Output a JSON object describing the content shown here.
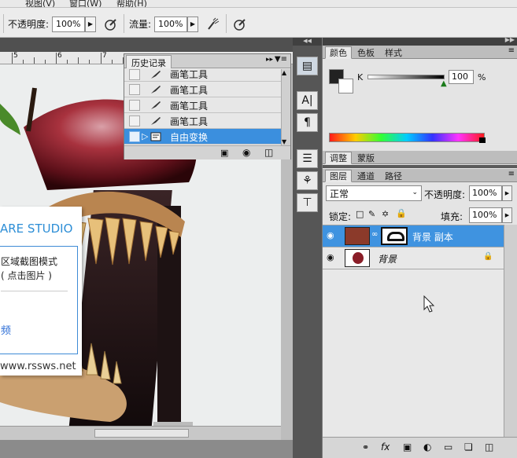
{
  "menubar": {
    "items": [
      "视图(V)",
      "窗口(W)",
      "帮助(H)"
    ]
  },
  "options": {
    "opacity_label": "不透明度:",
    "opacity_value": "100%",
    "flow_label": "流量:",
    "flow_value": "100%"
  },
  "ruler": {
    "labels": [
      "5",
      "6",
      "7"
    ]
  },
  "dialog": {
    "title": "ARE STUDIO",
    "line1": "区域截图模式",
    "line2": "( 点击图片 )",
    "link": "频",
    "url": "www.rssws.net"
  },
  "history": {
    "tab": "历史记录",
    "rows": [
      {
        "label": "画笔工具",
        "selected": false
      },
      {
        "label": "画笔工具",
        "selected": false
      },
      {
        "label": "画笔工具",
        "selected": false
      },
      {
        "label": "画笔工具",
        "selected": false
      },
      {
        "label": "自由变换",
        "selected": true
      }
    ]
  },
  "color_panel": {
    "tabs": [
      "颜色",
      "色板",
      "样式"
    ],
    "channel_label": "K",
    "value": "100",
    "unit": "%",
    "slider_level": 1.0
  },
  "adjust_panel": {
    "tabs": [
      "调整",
      "蒙版"
    ]
  },
  "layers_panel": {
    "tabs": [
      "图层",
      "通道",
      "路径"
    ],
    "blend_mode": "正常",
    "opacity_label": "不透明度:",
    "opacity_value": "100%",
    "lock_label": "锁定:",
    "fill_label": "填充:",
    "fill_value": "100%",
    "layers": [
      {
        "name": "背景 副本",
        "selected": true
      },
      {
        "name": "背景",
        "selected": false
      }
    ]
  },
  "colors": {
    "accent": "#3b8fde",
    "dialog_title": "#2d8ed6"
  }
}
